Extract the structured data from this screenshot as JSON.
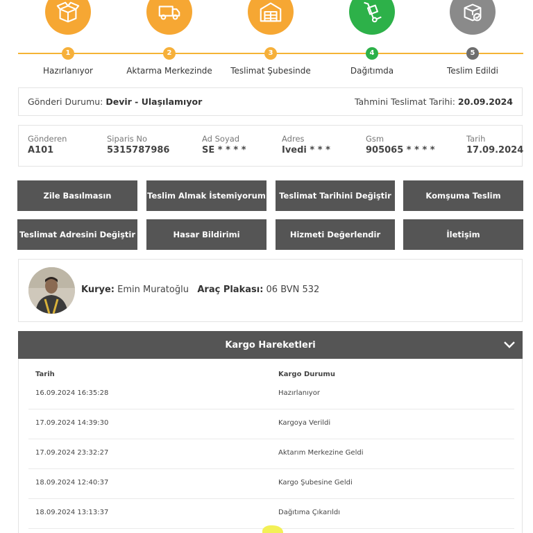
{
  "stepper": {
    "steps": [
      {
        "num": "1",
        "label": "Hazırlanıyor",
        "icon": "box-open-icon",
        "state": "done"
      },
      {
        "num": "2",
        "label": "Aktarma Merkezinde",
        "icon": "truck-icon",
        "state": "done"
      },
      {
        "num": "3",
        "label": "Teslimat Şubesinde",
        "icon": "warehouse-icon",
        "state": "done"
      },
      {
        "num": "4",
        "label": "Dağıtımda",
        "icon": "hand-truck-icon",
        "state": "active"
      },
      {
        "num": "5",
        "label": "Teslim Edildi",
        "icon": "box-check-icon",
        "state": "pending"
      }
    ]
  },
  "status": {
    "label": "Gönderi Durumu:",
    "value": "Devir - Ulaşılamıyor",
    "eta_label": "Tahmini Teslimat Tarihi:",
    "eta_value": "20.09.2024"
  },
  "info": {
    "sender_label": "Gönderen",
    "sender": "A101",
    "order_label": "Siparis No",
    "order": "5315787986",
    "name_label": "Ad Soyad",
    "name": "SE * * * *",
    "address_label": "Adres",
    "address": "Ivedi * * *",
    "gsm_label": "Gsm",
    "gsm": "905065 * * * *",
    "date_label": "Tarih",
    "date": "17.09.2024"
  },
  "actions": {
    "btn1": "Zile Basılmasın",
    "btn2": "Teslim Almak İstemiyorum",
    "btn3": "Teslimat Tarihini Değiştir",
    "btn4": "Komşuma Teslim",
    "btn5": "Teslimat Adresini Değiştir",
    "btn6": "Hasar Bildirimi",
    "btn7": "Hizmeti Değerlendir",
    "btn8": "İletişim"
  },
  "courier": {
    "courier_label": "Kurye:",
    "courier_name": "Emin Muratoğlu",
    "plate_label": "Araç Plakası:",
    "plate": "06 BVN 532"
  },
  "movements": {
    "title": "Kargo Hareketleri",
    "col_date": "Tarih",
    "col_status": "Kargo Durumu",
    "rows": [
      {
        "date": "16.09.2024 16:35:28",
        "status": "Hazırlanıyor"
      },
      {
        "date": "17.09.2024 14:39:30",
        "status": "Kargoya Verildi"
      },
      {
        "date": "17.09.2024 23:32:27",
        "status": "Aktarım Merkezine Geldi"
      },
      {
        "date": "18.09.2024 12:40:37",
        "status": "Kargo Şubesine Geldi"
      },
      {
        "date": "18.09.2024 13:13:37",
        "status": "Dağıtıma Çıkarıldı"
      }
    ]
  },
  "colors": {
    "done": "#f6a733",
    "active": "#2db149",
    "pending": "#8a8a8a",
    "button": "#555555"
  }
}
